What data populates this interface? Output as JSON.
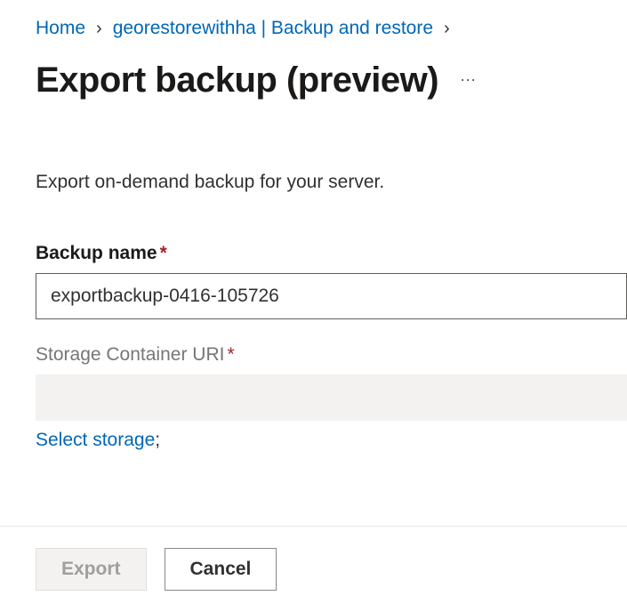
{
  "breadcrumb": {
    "home": "Home",
    "resource": "georestorewithha | Backup and restore"
  },
  "header": {
    "title": "Export backup (preview)",
    "moreLabel": "More actions"
  },
  "description": "Export on-demand backup for your server.",
  "form": {
    "backupName": {
      "label": "Backup name",
      "value": "exportbackup-0416-105726"
    },
    "storageUri": {
      "label": "Storage Container URI",
      "value": ""
    },
    "selectStorage": "Select storage"
  },
  "buttons": {
    "export": "Export",
    "cancel": "Cancel"
  }
}
